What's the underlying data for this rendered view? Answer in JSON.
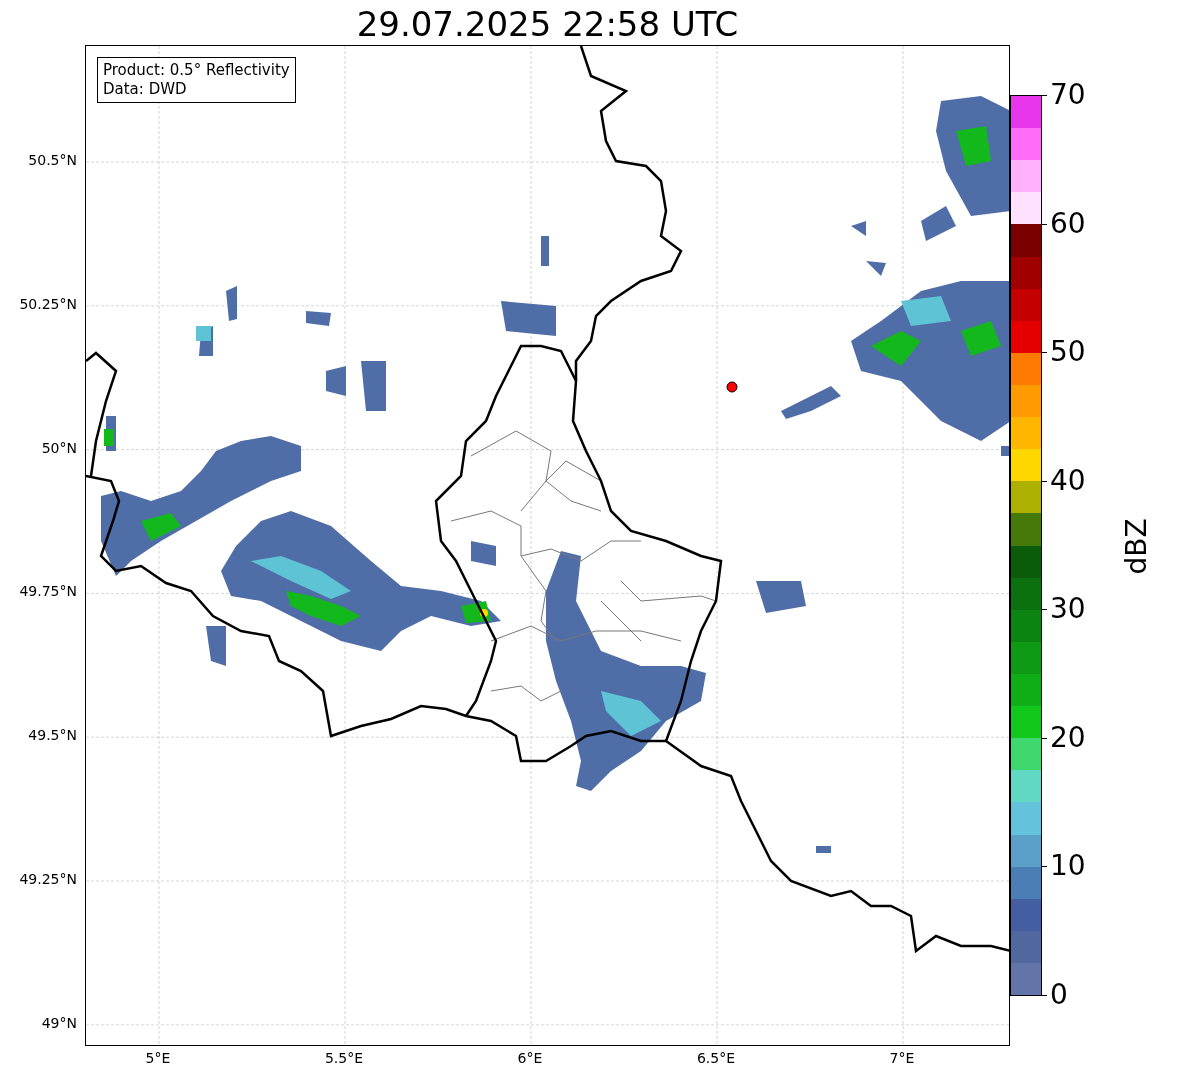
{
  "title": "29.07.2025 22:58 UTC",
  "map": {
    "info_box": [
      "Product: 0.5° Reflectivity",
      "Data: DWD"
    ],
    "lat_ticks": [
      "50.5°N",
      "50.25°N",
      "50°N",
      "49.75°N",
      "49.5°N",
      "49.25°N",
      "49°N"
    ],
    "lon_ticks": [
      "5°E",
      "5.5°E",
      "6°E",
      "6.5°E",
      "7°E"
    ]
  },
  "colorbar": {
    "label": "dBZ",
    "ticks": [
      "70",
      "60",
      "50",
      "40",
      "30",
      "20",
      "10",
      "0"
    ],
    "segments": [
      {
        "color": "#e836ec"
      },
      {
        "color": "#ff6cf7"
      },
      {
        "color": "#ffb2fb"
      },
      {
        "color": "#ffe0fd"
      },
      {
        "color": "#7a0000"
      },
      {
        "color": "#a00000"
      },
      {
        "color": "#c40000"
      },
      {
        "color": "#e40000"
      },
      {
        "color": "#ff7a00"
      },
      {
        "color": "#ff9a00"
      },
      {
        "color": "#ffb600"
      },
      {
        "color": "#ffd700"
      },
      {
        "color": "#adb000"
      },
      {
        "color": "#457a0a"
      },
      {
        "color": "#0a5c0a"
      },
      {
        "color": "#0b700e"
      },
      {
        "color": "#0c8412"
      },
      {
        "color": "#0e9a14"
      },
      {
        "color": "#0fae17"
      },
      {
        "color": "#11c81a"
      },
      {
        "color": "#3fd86e"
      },
      {
        "color": "#60d8c4"
      },
      {
        "color": "#63c3dc"
      },
      {
        "color": "#5aa0c8"
      },
      {
        "color": "#4a7eb4"
      },
      {
        "color": "#435fa2"
      },
      {
        "color": "#51689f"
      },
      {
        "color": "#6375a8"
      }
    ]
  }
}
